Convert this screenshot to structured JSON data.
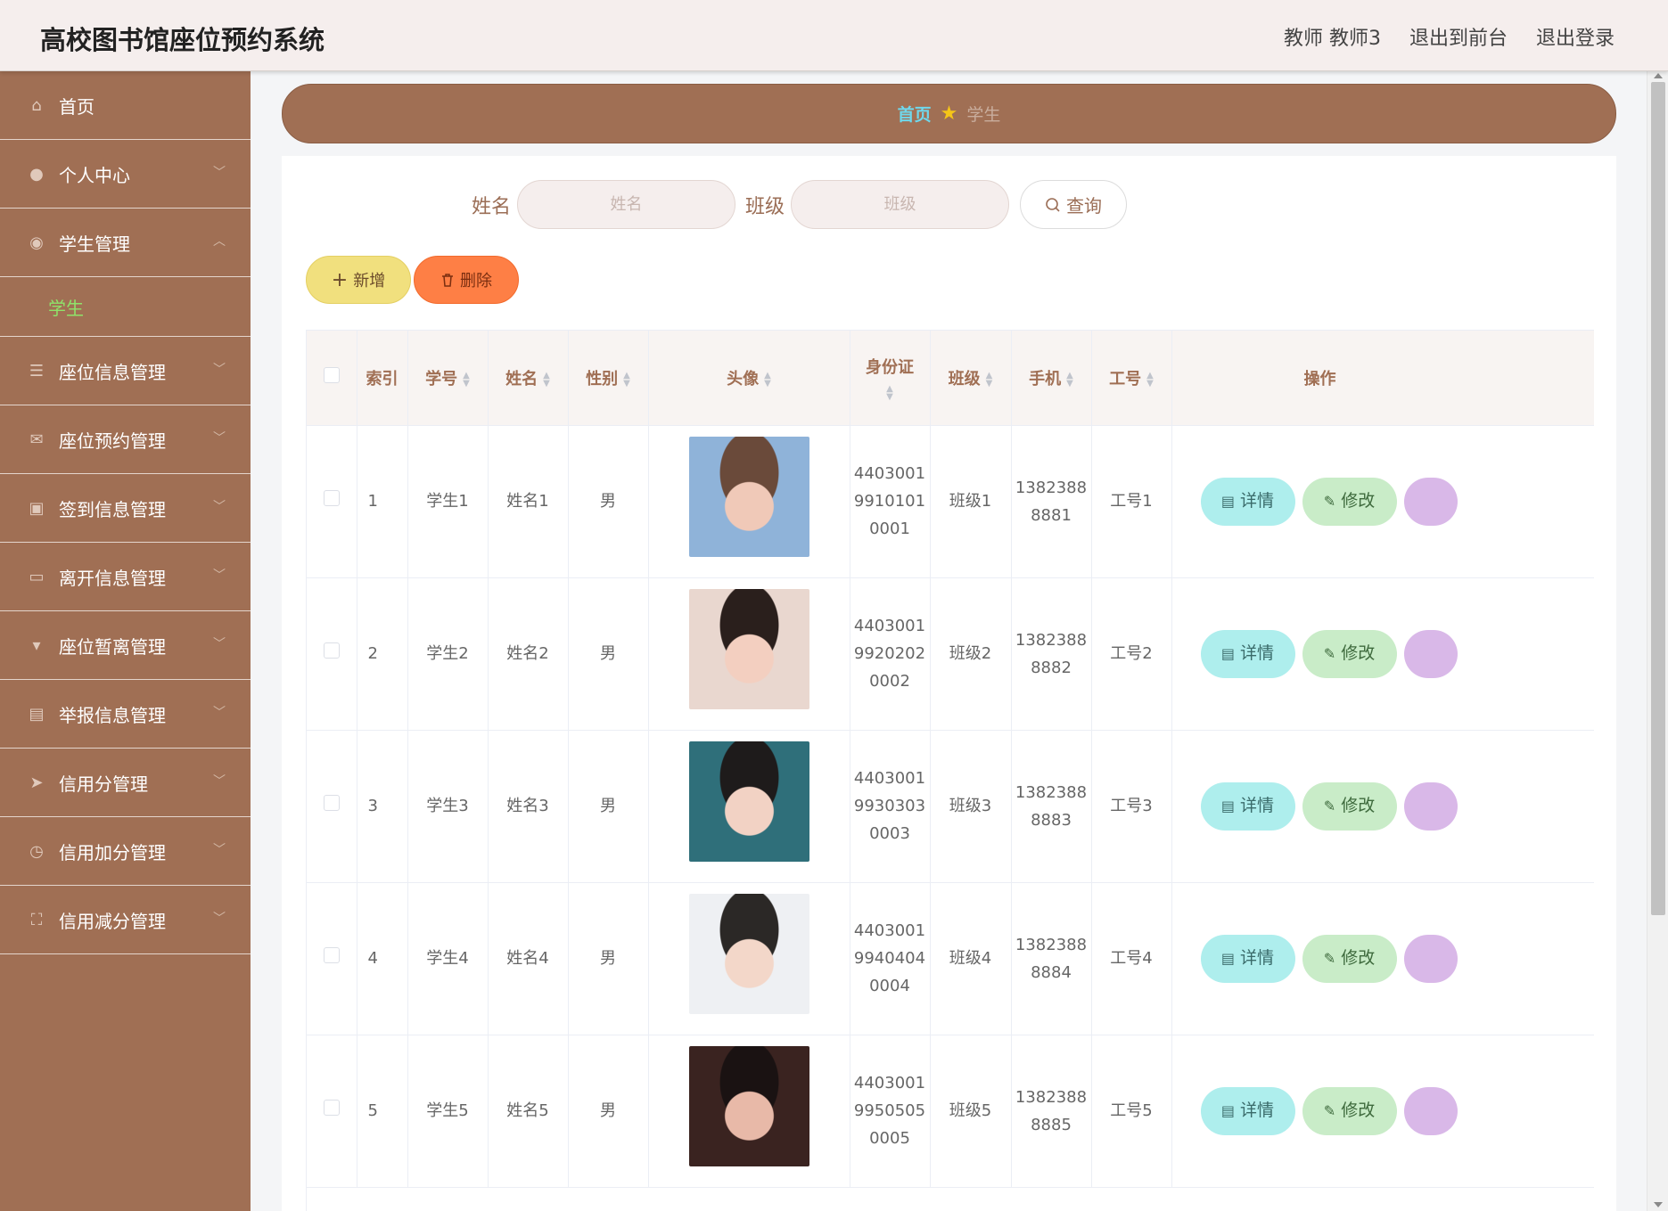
{
  "header": {
    "title": "高校图书馆座位预约系统",
    "user": "教师 教师3",
    "to_front": "退出到前台",
    "logout": "退出登录"
  },
  "sidebar": {
    "items": [
      {
        "label": "首页",
        "icon": "home-icon",
        "glyph": "⌂"
      },
      {
        "label": "个人中心",
        "icon": "user-icon",
        "glyph": "●"
      },
      {
        "label": "学生管理",
        "icon": "bulb-icon",
        "glyph": "◉",
        "expanded": true,
        "children": [
          "学生"
        ]
      },
      {
        "label": "座位信息管理",
        "icon": "list-icon",
        "glyph": "☰"
      },
      {
        "label": "座位预约管理",
        "icon": "mail-icon",
        "glyph": "✉"
      },
      {
        "label": "签到信息管理",
        "icon": "camera-icon",
        "glyph": "▣"
      },
      {
        "label": "离开信息管理",
        "icon": "chat-icon",
        "glyph": "▭"
      },
      {
        "label": "座位暂离管理",
        "icon": "stamp-icon",
        "glyph": "▾"
      },
      {
        "label": "举报信息管理",
        "icon": "clipboard-icon",
        "glyph": "▤"
      },
      {
        "label": "信用分管理",
        "icon": "send-icon",
        "glyph": "➤"
      },
      {
        "label": "信用加分管理",
        "icon": "clock-icon",
        "glyph": "◷"
      },
      {
        "label": "信用减分管理",
        "icon": "fullscreen-icon",
        "glyph": "⛶"
      }
    ]
  },
  "breadcrumb": {
    "home": "首页",
    "current": "学生"
  },
  "search": {
    "name_label": "姓名",
    "name_placeholder": "姓名",
    "class_label": "班级",
    "class_placeholder": "班级",
    "query_button": "查询"
  },
  "actions": {
    "add": "新增",
    "delete": "删除"
  },
  "table": {
    "headers": {
      "index": "索引",
      "student_no": "学号",
      "name": "姓名",
      "gender": "性别",
      "avatar": "头像",
      "id_card": "身份证",
      "class": "班级",
      "phone": "手机",
      "job_no": "工号",
      "ops": "操作"
    },
    "detail_label": "详情",
    "edit_label": "修改",
    "rows": [
      {
        "index": "1",
        "student_no": "学生1",
        "name": "姓名1",
        "gender": "男",
        "id_l1": "4403001",
        "id_l2": "9910101",
        "id_l3": "0001",
        "class": "班级1",
        "phone_l1": "1382388",
        "phone_l2": "8881",
        "job_no": "工号1",
        "avatar_colors": [
          "#8fb3d9",
          "#f0c9b8",
          "#6a4a3a"
        ]
      },
      {
        "index": "2",
        "student_no": "学生2",
        "name": "姓名2",
        "gender": "男",
        "id_l1": "4403001",
        "id_l2": "9920202",
        "id_l3": "0002",
        "class": "班级2",
        "phone_l1": "1382388",
        "phone_l2": "8882",
        "job_no": "工号2",
        "avatar_colors": [
          "#e9d7cf",
          "#f3cfc0",
          "#2a1f1c"
        ]
      },
      {
        "index": "3",
        "student_no": "学生3",
        "name": "姓名3",
        "gender": "男",
        "id_l1": "4403001",
        "id_l2": "9930303",
        "id_l3": "0003",
        "class": "班级3",
        "phone_l1": "1382388",
        "phone_l2": "8883",
        "job_no": "工号3",
        "avatar_colors": [
          "#2f6f7a",
          "#f2d2c4",
          "#1e1b1b"
        ]
      },
      {
        "index": "4",
        "student_no": "学生4",
        "name": "姓名4",
        "gender": "男",
        "id_l1": "4403001",
        "id_l2": "9940404",
        "id_l3": "0004",
        "class": "班级4",
        "phone_l1": "1382388",
        "phone_l2": "8884",
        "job_no": "工号4",
        "avatar_colors": [
          "#eef0f3",
          "#f3d7c9",
          "#2b2826"
        ]
      },
      {
        "index": "5",
        "student_no": "学生5",
        "name": "姓名5",
        "gender": "男",
        "id_l1": "4403001",
        "id_l2": "9950505",
        "id_l3": "0005",
        "class": "班级5",
        "phone_l1": "1382388",
        "phone_l2": "8885",
        "job_no": "工号5",
        "avatar_colors": [
          "#3a2320",
          "#e8b9a8",
          "#1a1212"
        ]
      }
    ]
  },
  "colors": {
    "brand": "#a06f54",
    "header_bg": "#f5eeed",
    "active_submenu": "#8fe36a",
    "crumb_home": "#6fd8ec",
    "star": "#f5c518",
    "add_button": "#f1e07e",
    "delete_button": "#fe7f45",
    "detail_button": "#aeeeed",
    "edit_button": "#c9ecc8"
  }
}
